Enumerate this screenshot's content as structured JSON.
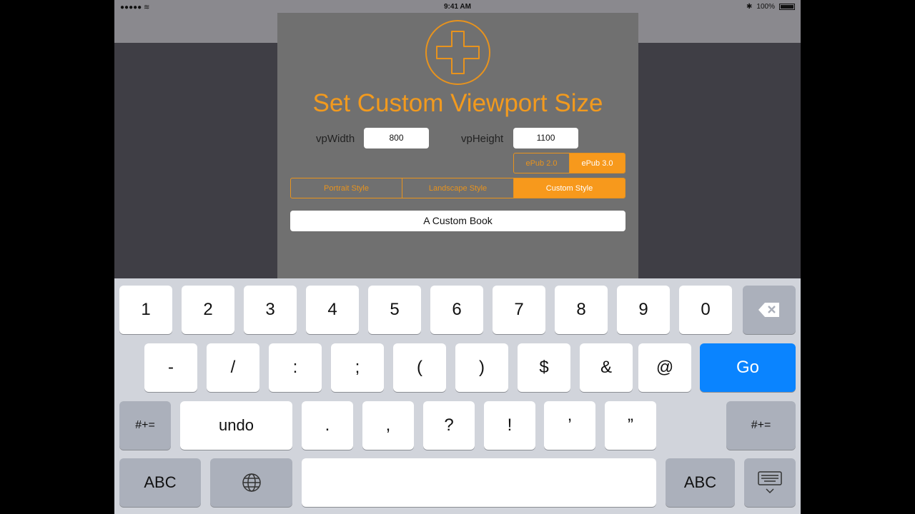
{
  "status": {
    "time": "9:41 AM",
    "battery": "100%"
  },
  "dialog": {
    "title": "Set Custom Viewport Size",
    "width_label": "vpWidth",
    "width_value": "800",
    "height_label": "vpHeight",
    "height_value": "1100",
    "epub_options": [
      "ePub 2.0",
      "ePub 3.0"
    ],
    "epub_selected": "ePub 3.0",
    "style_options": [
      "Portrait Style",
      "Landscape Style",
      "Custom Style"
    ],
    "style_selected": "Custom Style",
    "book_name": "A Custom Book",
    "accent_color": "#f7991c"
  },
  "keyboard": {
    "row1": [
      "1",
      "2",
      "3",
      "4",
      "5",
      "6",
      "7",
      "8",
      "9",
      "0"
    ],
    "row2": [
      "-",
      "/",
      ":",
      ";",
      "(",
      ")",
      "$",
      "&",
      "@"
    ],
    "go": "Go",
    "row3_left": "#+=",
    "undo": "undo",
    "row3": [
      ".",
      ",",
      "?",
      "!",
      "’",
      "”"
    ],
    "row3_right": "#+=",
    "abc_left": "ABC",
    "abc_right": "ABC",
    "go_color": "#0a84ff"
  }
}
